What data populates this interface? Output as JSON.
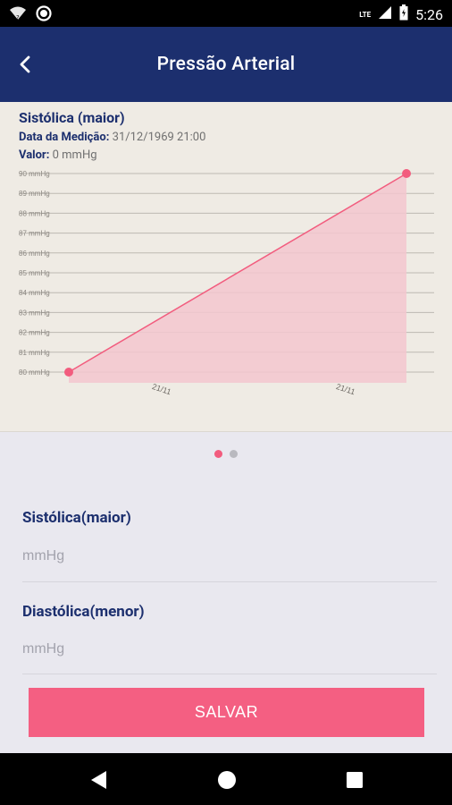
{
  "status_bar": {
    "time": "5:26",
    "lte_label": "LTE",
    "icons": [
      "wifi-icon",
      "circle-notification-icon",
      "lte-icon",
      "signal-icon",
      "battery-icon"
    ]
  },
  "app_bar": {
    "title": "Pressão Arterial",
    "back_icon": "chevron-left-icon"
  },
  "chart_card": {
    "title": "Sistólica (maior)",
    "date_label": "Data da Medição:",
    "date_value": "31/12/1969 21:00",
    "value_label": "Valor:",
    "value_value": "0 mmHg"
  },
  "chart_data": {
    "type": "area",
    "x": [
      "21/11",
      "21/11"
    ],
    "series": [
      {
        "values": [
          80,
          90
        ]
      }
    ],
    "yticks": [
      "80 mmHg",
      "81 mmHg",
      "82 mmHg",
      "83 mmHg",
      "84 mmHg",
      "85 mmHg",
      "86 mmHg",
      "87 mmHg",
      "88 mmHg",
      "89 mmHg",
      "90 mmHg"
    ],
    "ylim": [
      80,
      90
    ],
    "grid": true,
    "colors": {
      "line": "#f25c7e",
      "fill": "#f3c7cf",
      "grid": "#bdb9b2"
    }
  },
  "pager": {
    "count": 2,
    "active": 0,
    "active_color": "#f25c7e",
    "inactive_color": "#b9b9bf"
  },
  "form": {
    "systolic_label": "Sistólica(maior)",
    "systolic_placeholder": "mmHg",
    "diastolic_label": "Diastólica(menor)",
    "diastolic_placeholder": "mmHg",
    "save_label": "SALVAR"
  },
  "nav_bar": {
    "icons": [
      "back-triangle-icon",
      "home-circle-icon",
      "recents-square-icon"
    ]
  }
}
